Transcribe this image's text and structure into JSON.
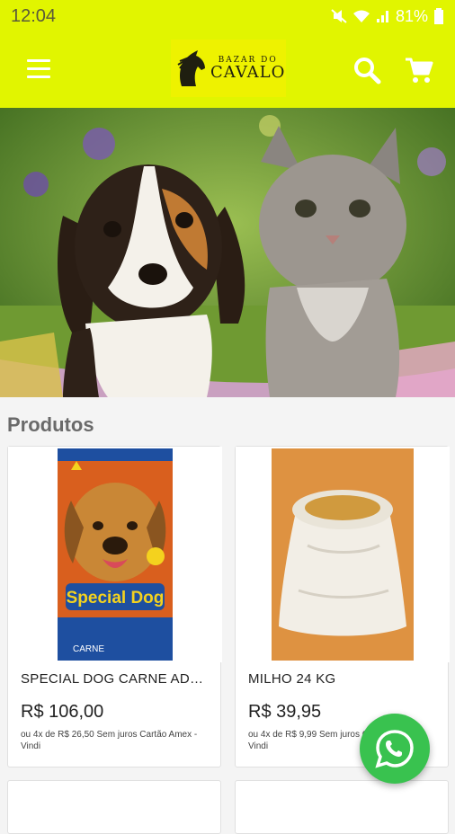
{
  "status": {
    "time": "12:04",
    "battery": "81%"
  },
  "header": {
    "logo_top": "BAZAR DO",
    "logo_main": "CAVALO"
  },
  "section": {
    "title": "Produtos"
  },
  "products": [
    {
      "title": "SPECIAL DOG CARNE ADUL…",
      "price": "R$ 106,00",
      "installments": "ou 4x de R$ 26,50 Sem juros Cartão Amex - Vindi",
      "pack_brand": "Special Dog",
      "pack_flavor": "CARNE"
    },
    {
      "title": "MILHO 24 KG",
      "price": "R$ 39,95",
      "installments": "ou 4x de R$ 9,99 Sem juros Cartão Amex - Vindi"
    }
  ],
  "colors": {
    "accent": "#e1f500",
    "whatsapp": "#39c24f"
  },
  "icons": [
    "menu-icon",
    "search-icon",
    "cart-icon",
    "whatsapp-icon"
  ]
}
